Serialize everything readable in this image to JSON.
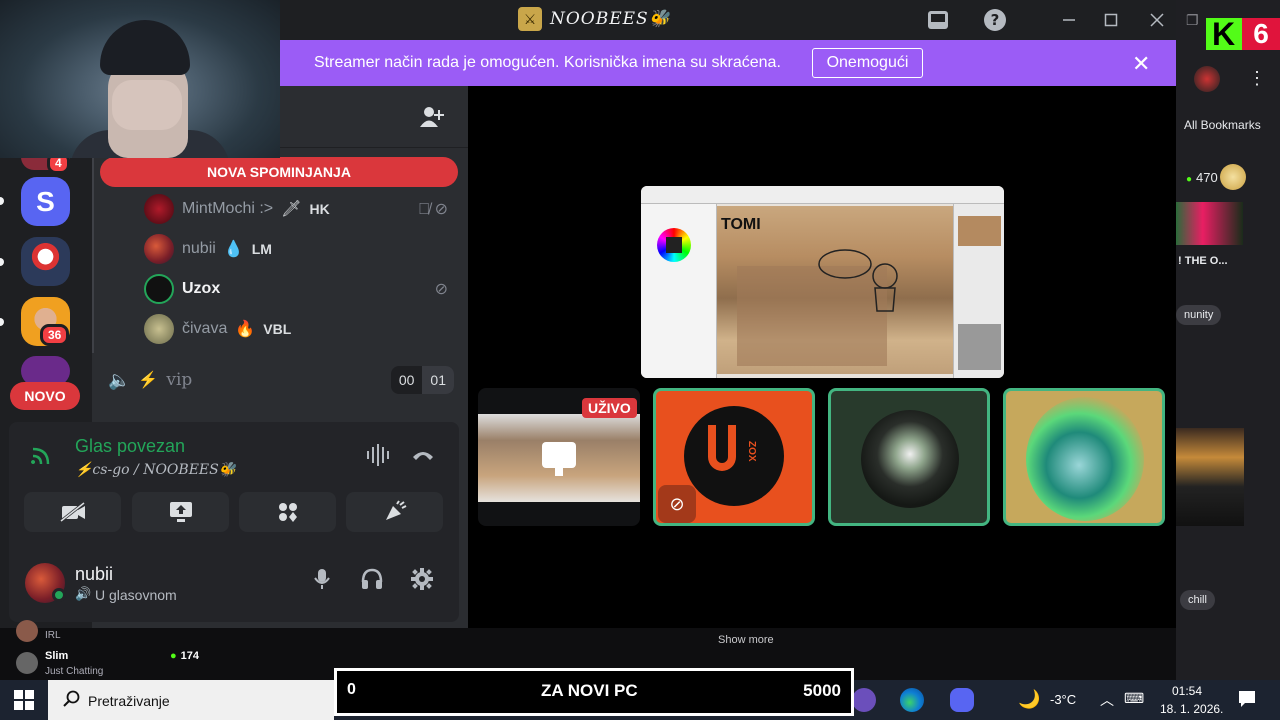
{
  "window": {
    "title": "NOOBEES🐝",
    "server_icon": "⚔"
  },
  "banner": {
    "text": "Streamer način rada je omogućen. Korisnička imena su skraćena.",
    "button": "Onemogući",
    "close": "✕"
  },
  "rail": {
    "server_s": "S",
    "badge_top": "4",
    "badge_36": "36",
    "novo": "NOVO"
  },
  "channels": {
    "mentions": "NOVA SPOMINJANJA",
    "users": [
      {
        "name": "MintMochi :>",
        "tag_icon": "🗡",
        "tag": "HK"
      },
      {
        "name": "nubii",
        "tag_icon": "💧",
        "tag": "LM"
      },
      {
        "name": "Uzox",
        "tag_icon": "",
        "tag": ""
      },
      {
        "name": "čivava",
        "tag_icon": "🔥",
        "tag": "VBL"
      }
    ],
    "vip": {
      "label": "vip",
      "icon": "⚡",
      "count_a": "00",
      "count_b": "01"
    }
  },
  "voice": {
    "status": "Glas povezan",
    "channel": "⚡cs-go / NOOBEES🐝",
    "user": {
      "name": "nubii",
      "status": "U glasovnom"
    }
  },
  "stage": {
    "live_badge": "UŽIVO",
    "screenshare_text": "TOMI",
    "uzox_label": "ZOX"
  },
  "browser": {
    "kick_k": "K",
    "kick_6": "6",
    "bookmarks": "All Bookmarks",
    "count": "470",
    "title": "! THE O...",
    "pill1": "nunity",
    "pill2": "chill"
  },
  "feed": {
    "show_more": "Show more",
    "ch1_sub": "IRL",
    "ch2_name": "Slim",
    "ch2_sub": "Just Chatting",
    "ch2_viewers": "174"
  },
  "taskbar": {
    "search": "Pretraživanje",
    "goal_left": "0",
    "goal_title": "ZA NOVI PC",
    "goal_right": "5000",
    "temp": "-3°C",
    "time": "01:54",
    "date": "18. 1. 2026."
  },
  "colors": {
    "accent": "#9b5cf6",
    "danger": "#da373c",
    "online": "#23a559",
    "kick": "#53fc18"
  }
}
